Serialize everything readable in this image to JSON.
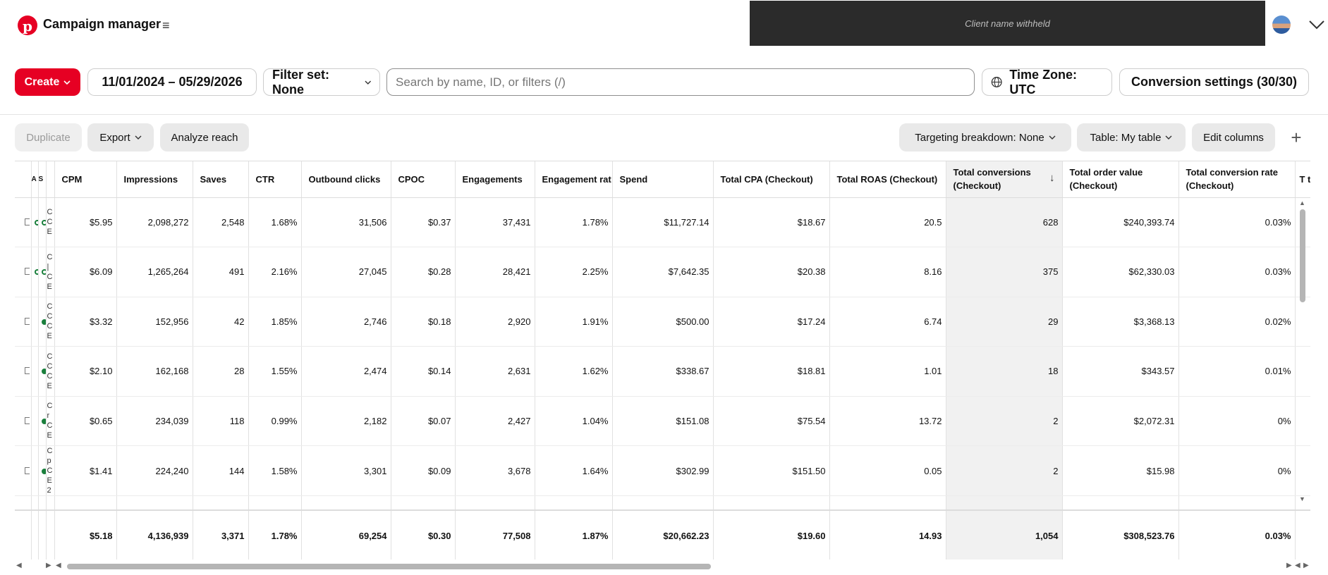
{
  "header": {
    "logo_letter": "p",
    "app_title": "Campaign manager",
    "menu_icon": "≡",
    "client_name": "Client name withheld"
  },
  "toolbar": {
    "create_label": "Create",
    "date_range": "11/01/2024 – 05/29/2026",
    "filter_set": "Filter set: None",
    "search_placeholder": "Search by name, ID, or filters (/)",
    "time_zone": "Time Zone: UTC",
    "conversion_settings": "Conversion settings (30/30)"
  },
  "actions": {
    "duplicate": "Duplicate",
    "export": "Export",
    "analyze_reach": "Analyze reach",
    "targeting_breakdown": "Targeting breakdown: None",
    "table": "Table: My table",
    "edit_columns": "Edit columns",
    "add": "+"
  },
  "table": {
    "lead_headers": [
      "A",
      "S"
    ],
    "columns": [
      "CPM",
      "Impressions",
      "Saves",
      "CTR",
      "Outbound clicks",
      "CPOC",
      "Engagements",
      "Engagement rat",
      "Spend",
      "Total CPA (Checkout)",
      "Total ROAS (Checkout)",
      "Total conversions (Checkout)",
      "Total order value (Checkout)",
      "Total conversion rate (Checkout)",
      "T t"
    ],
    "rows": [
      {
        "name_stub": "C C E",
        "cells": [
          "$5.95",
          "2,098,272",
          "2,548",
          "1.68%",
          "31,506",
          "$0.37",
          "37,431",
          "1.78%",
          "$11,727.14",
          "$18.67",
          "20.5",
          "628",
          "$240,393.74",
          "0.03%",
          ""
        ]
      },
      {
        "name_stub": "C | C E",
        "cells": [
          "$6.09",
          "1,265,264",
          "491",
          "2.16%",
          "27,045",
          "$0.28",
          "28,421",
          "2.25%",
          "$7,642.35",
          "$20.38",
          "8.16",
          "375",
          "$62,330.03",
          "0.03%",
          ""
        ]
      },
      {
        "name_stub": "C C C E",
        "cells": [
          "$3.32",
          "152,956",
          "42",
          "1.85%",
          "2,746",
          "$0.18",
          "2,920",
          "1.91%",
          "$500.00",
          "$17.24",
          "6.74",
          "29",
          "$3,368.13",
          "0.02%",
          ""
        ]
      },
      {
        "name_stub": "C C C E",
        "cells": [
          "$2.10",
          "162,168",
          "28",
          "1.55%",
          "2,474",
          "$0.14",
          "2,631",
          "1.62%",
          "$338.67",
          "$18.81",
          "1.01",
          "18",
          "$343.57",
          "0.01%",
          ""
        ]
      },
      {
        "name_stub": "C r C E",
        "cells": [
          "$0.65",
          "234,039",
          "118",
          "0.99%",
          "2,182",
          "$0.07",
          "2,427",
          "1.04%",
          "$151.08",
          "$75.54",
          "13.72",
          "2",
          "$2,072.31",
          "0%",
          ""
        ]
      },
      {
        "name_stub": "C p C E 2",
        "cells": [
          "$1.41",
          "224,240",
          "144",
          "1.58%",
          "3,301",
          "$0.09",
          "3,678",
          "1.64%",
          "$302.99",
          "$151.50",
          "0.05",
          "2",
          "$15.98",
          "0%",
          ""
        ]
      }
    ],
    "totals": [
      "$5.18",
      "4,136,939",
      "3,371",
      "1.78%",
      "69,254",
      "$0.30",
      "77,508",
      "1.87%",
      "$20,662.23",
      "$19.60",
      "14.93",
      "1,054",
      "$308,523.76",
      "0.03%",
      ""
    ]
  },
  "colors": {
    "brand": "#e60023",
    "client_box": "#2b2b2b",
    "status_active": "#1a7f3c"
  },
  "icons": [
    "pinterest-logo",
    "hamburger-menu-icon",
    "avatar",
    "chevron-down-icon",
    "globe-icon",
    "sort-down-arrow-icon",
    "plus-icon",
    "scroll-arrow-icons"
  ]
}
